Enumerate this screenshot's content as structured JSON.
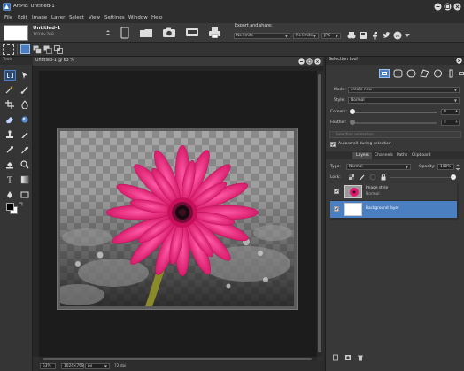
{
  "app": {
    "title": "ArtPic: Untitled-1"
  },
  "menu": [
    "File",
    "Edit",
    "Image",
    "Layer",
    "Select",
    "View",
    "Settings",
    "Window",
    "Help"
  ],
  "document": {
    "name": "Untitled-1",
    "size": "1024×768",
    "window_title": "Untitled-1 @ 63 %"
  },
  "export": {
    "label": "Export and share:",
    "width_select": "No limits",
    "height_select": "No limits",
    "format_select": "JPG"
  },
  "tools_panel": {
    "title": "Tools"
  },
  "selection_tool": {
    "title": "Selection tool",
    "mode_label": "Mode:",
    "mode_value": "create new",
    "style_label": "Style:",
    "style_value": "Normal",
    "corners_label": "Corners:",
    "corners_value": "0",
    "feather_label": "Feather:",
    "feather_value": "0",
    "animation_button": "Selection animation",
    "autoscroll_label": "Autoscroll during selection",
    "autoscroll_checked": true
  },
  "layers_panel": {
    "tabs": [
      "Layers",
      "Channels",
      "Paths",
      "Clipboard"
    ],
    "type_label": "Type:",
    "type_value": "Normal",
    "opacity_label": "Opacity:",
    "opacity_value": "100%",
    "lock_label": "Lock:",
    "layers": [
      {
        "name": "Image style",
        "blend": "Normal",
        "visible": true,
        "selected": false
      },
      {
        "name": "Background layer",
        "blend": "",
        "visible": true,
        "selected": true
      }
    ]
  },
  "status_bar": {
    "zoom": "63%",
    "size": "1024×768",
    "unit": "px",
    "dpi": "72 dpi"
  },
  "colors": {
    "accent": "#4a7fc1",
    "selected_layer": "#4a7fc1",
    "flower": "#e0186e"
  },
  "icons": [
    "app-logo-icon",
    "minimize-icon",
    "maximize-icon",
    "close-icon",
    "facebook-icon",
    "twitter-icon",
    "vk-icon"
  ]
}
